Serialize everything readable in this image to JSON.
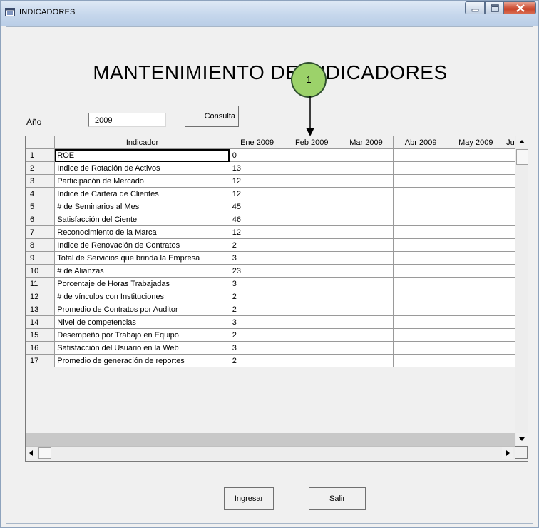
{
  "window": {
    "title": "INDICADORES"
  },
  "form": {
    "heading": "MANTENIMIENTO DE INDICADORES",
    "year_label": "Año",
    "year_value": "2009",
    "consulta_label": "Consulta",
    "ingresar_label": "Ingresar",
    "salir_label": "Salir"
  },
  "callout": {
    "number": "1"
  },
  "grid": {
    "columns": [
      "Indicador",
      "Ene 2009",
      "Feb 2009",
      "Mar 2009",
      "Abr 2009",
      "May 2009",
      "Ju"
    ],
    "rows": [
      {
        "num": "1",
        "indicador": "ROE",
        "ene": "0"
      },
      {
        "num": "2",
        "indicador": "Indice de Rotación de Activos",
        "ene": "13"
      },
      {
        "num": "3",
        "indicador": "Participacón de Mercado",
        "ene": "12"
      },
      {
        "num": "4",
        "indicador": "Indice de Cartera de Clientes",
        "ene": "12"
      },
      {
        "num": "5",
        "indicador": "# de Seminarios al Mes",
        "ene": "45"
      },
      {
        "num": "6",
        "indicador": "Satisfacción del Ciente",
        "ene": "46"
      },
      {
        "num": "7",
        "indicador": "Reconocimiento de la Marca",
        "ene": "12"
      },
      {
        "num": "8",
        "indicador": "Indice de Renovación de Contratos",
        "ene": "2"
      },
      {
        "num": "9",
        "indicador": "Total de Servicios que brinda la Empresa",
        "ene": "3"
      },
      {
        "num": "10",
        "indicador": "# de Alianzas",
        "ene": "23"
      },
      {
        "num": "11",
        "indicador": "Porcentaje de Horas Trabajadas",
        "ene": "3"
      },
      {
        "num": "12",
        "indicador": "# de vínculos con Instituciones",
        "ene": "2"
      },
      {
        "num": "13",
        "indicador": "Promedio de Contratos por Auditor",
        "ene": "2"
      },
      {
        "num": "14",
        "indicador": "Nivel de competencias",
        "ene": "3"
      },
      {
        "num": "15",
        "indicador": "Desempeño por Trabajo en Equipo",
        "ene": "2"
      },
      {
        "num": "16",
        "indicador": "Satisfacción del Usuario en la Web",
        "ene": "3"
      },
      {
        "num": "17",
        "indicador": "Promedio de generación de reportes",
        "ene": "2"
      }
    ]
  },
  "colors": {
    "callout_fill": "#9cd26a",
    "close_button": "#c9452a",
    "titlebar": "#c6d7ec"
  }
}
